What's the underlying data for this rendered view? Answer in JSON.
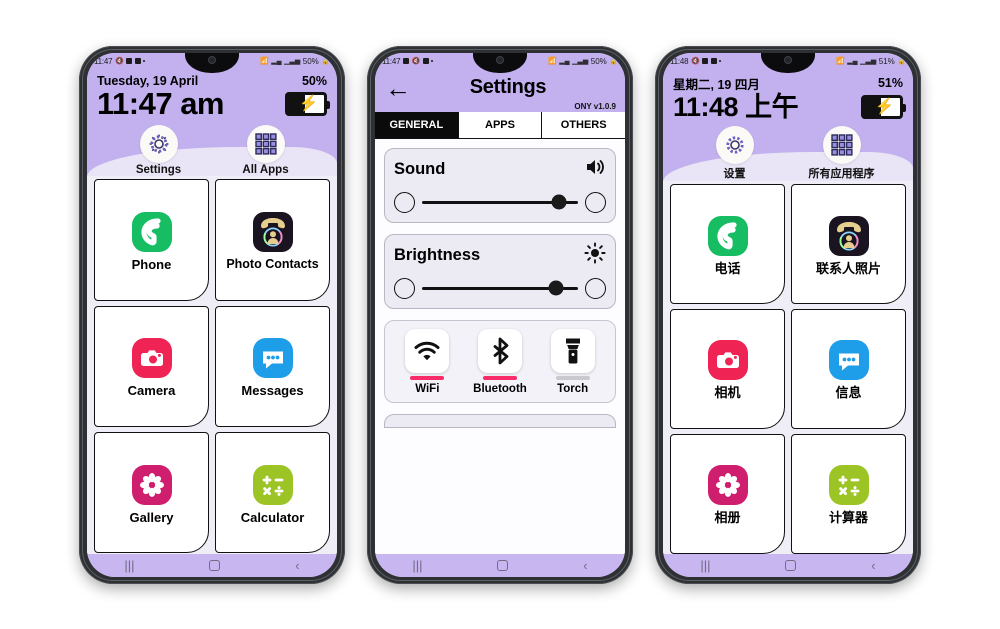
{
  "page": {
    "background": "#ffffff"
  },
  "theme": {
    "purple": "#c2b1ee",
    "nav_purple": "#c7b6f0",
    "home_body": "#efedf6",
    "accent_pink": "#f72c68",
    "inactive_gray": "#c9c9cf"
  },
  "phone1": {
    "status": {
      "time": "11:47",
      "battery_percent": "50%",
      "icons": [
        "mute-icon",
        "image-icon",
        "video-icon",
        "dot-icon"
      ],
      "right_icons": [
        "wifi-icon",
        "sim-signal-icon",
        "signal-icon",
        "lock-icon"
      ]
    },
    "header": {
      "date": "Tuesday, 19 April",
      "battery_label": "50%",
      "clock": "11:47 am"
    },
    "quick": [
      {
        "label": "Settings",
        "icon": "gear-icon"
      },
      {
        "label": "All Apps",
        "icon": "grid-icon"
      }
    ],
    "apps": [
      {
        "label": "Phone",
        "icon": "phone-icon"
      },
      {
        "label": "Photo Contacts",
        "icon": "photo-contacts-icon"
      },
      {
        "label": "Camera",
        "icon": "camera-icon"
      },
      {
        "label": "Messages",
        "icon": "messages-icon"
      },
      {
        "label": "Gallery",
        "icon": "gallery-icon"
      },
      {
        "label": "Calculator",
        "icon": "calculator-icon"
      }
    ],
    "nav": {
      "recents": "|||",
      "home": "home-square-icon",
      "back": "‹"
    }
  },
  "phone2": {
    "status": {
      "time": "11:47",
      "battery_percent": "50%"
    },
    "header": {
      "back": "←",
      "title": "Settings",
      "version": "ONY v1.0.9"
    },
    "tabs": [
      {
        "label": "GENERAL",
        "active": true
      },
      {
        "label": "APPS",
        "active": false
      },
      {
        "label": "OTHERS",
        "active": false
      }
    ],
    "sound": {
      "title": "Sound",
      "icon": "speaker-icon",
      "minus": "−",
      "plus": "+",
      "value": 88
    },
    "brightness": {
      "title": "Brightness",
      "icon": "sun-icon",
      "minus": "−",
      "plus": "+",
      "value": 86
    },
    "toggles": [
      {
        "label": "WiFi",
        "icon": "wifi-icon",
        "on": true
      },
      {
        "label": "Bluetooth",
        "icon": "bluetooth-icon",
        "on": true
      },
      {
        "label": "Torch",
        "icon": "torch-icon",
        "on": false
      }
    ],
    "nav": {
      "recents": "|||",
      "home": "home-square-icon",
      "back": "‹"
    }
  },
  "phone3": {
    "status": {
      "time": "11:48",
      "battery_percent": "51%"
    },
    "header": {
      "date": "星期二, 19 四月",
      "battery_label": "51%",
      "clock": "11:48 上午"
    },
    "quick": [
      {
        "label": "设置",
        "icon": "gear-icon"
      },
      {
        "label": "所有应用程序",
        "icon": "grid-icon"
      }
    ],
    "apps": [
      {
        "label": "电话",
        "icon": "phone-icon"
      },
      {
        "label": "联系人照片",
        "icon": "photo-contacts-icon"
      },
      {
        "label": "相机",
        "icon": "camera-icon"
      },
      {
        "label": "信息",
        "icon": "messages-icon"
      },
      {
        "label": "相册",
        "icon": "gallery-icon"
      },
      {
        "label": "计算器",
        "icon": "calculator-icon"
      }
    ],
    "nav": {
      "recents": "|||",
      "home": "home-square-icon",
      "back": "‹"
    }
  }
}
